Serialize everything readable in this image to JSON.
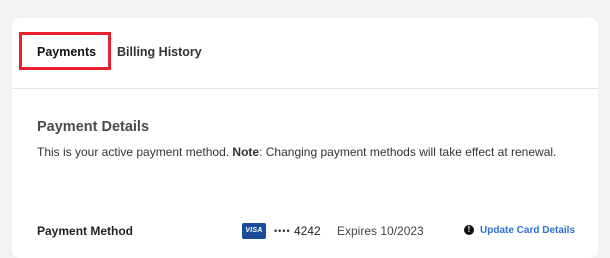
{
  "tabs": {
    "payments_label": "Payments",
    "billing_history_label": "Billing History"
  },
  "payment_details": {
    "title": "Payment Details",
    "description_prefix": "This is your active payment method. ",
    "note_label": "Note",
    "description_suffix": ": Changing payment methods will take effect at renewal."
  },
  "payment_method": {
    "label": "Payment Method",
    "card_brand": "VISA",
    "masked_dots": "••••",
    "last_four": "4242",
    "expiry": "Expires 10/2023",
    "alert_icon": "exclamation-circle-icon",
    "update_label": "Update Card Details"
  },
  "colors": {
    "highlight": "#e8202e",
    "link": "#2f6fd6",
    "visa": "#1a4c9c"
  }
}
